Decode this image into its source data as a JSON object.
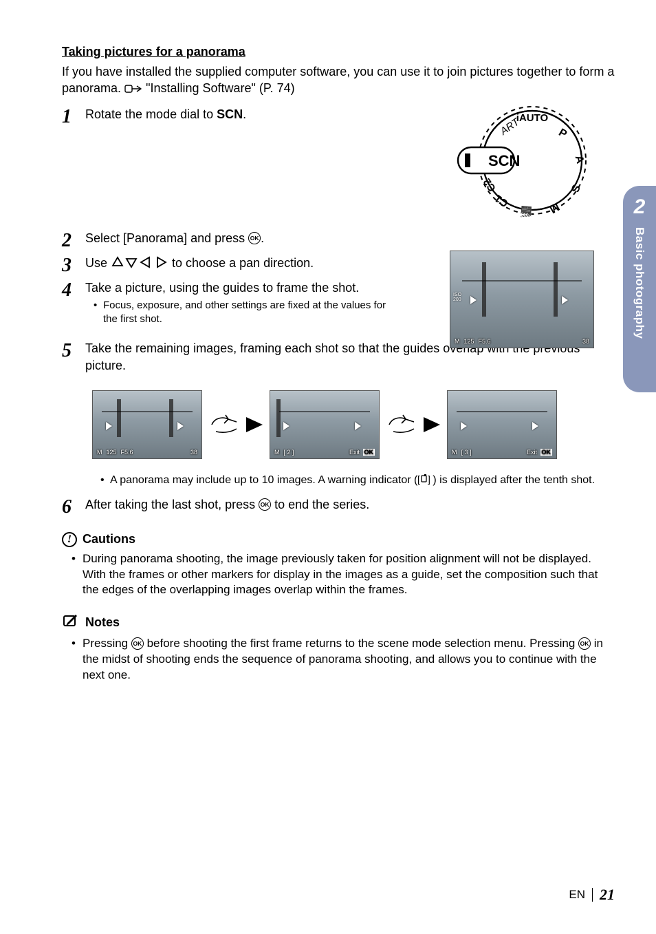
{
  "sideTab": {
    "chapterNum": "2",
    "title": "Basic photography"
  },
  "heading": "Taking pictures for a panorama",
  "intro": {
    "part1": "If you have installed the supplied computer software, you can use it to join pictures together to form a panorama. ",
    "refText": "\"Installing Software\" (P. 74)"
  },
  "steps": {
    "s1": {
      "num": "1",
      "text_a": "Rotate the mode dial to ",
      "scn": "SCN",
      "text_b": "."
    },
    "s2": {
      "num": "2",
      "text_a": "Select [Panorama] and press ",
      "text_b": "."
    },
    "s3": {
      "num": "3",
      "text_a": "Use ",
      "text_b": " to choose a pan direction."
    },
    "s4": {
      "num": "4",
      "text": "Take a picture, using the guides to frame the shot.",
      "bullet": "Focus, exposure, and other settings are fixed at the values for the first shot."
    },
    "s5": {
      "num": "5",
      "text": "Take the remaining images, framing each shot so that the guides overlap with the previous picture.",
      "bullet_a": "A panorama may include up to 10 images. A warning indicator (",
      "bullet_b": ") is displayed after the tenth shot."
    },
    "s6": {
      "num": "6",
      "text_a": "After taking the last shot, press ",
      "text_b": " to end the series."
    }
  },
  "lcd": {
    "iso": "ISO\n200",
    "shutter": "125",
    "aperture": "F5.6",
    "shots": "38",
    "exit": "Exit",
    "ok": "OK",
    "count2": "[ 2 ]",
    "count3": "[ 3 ]",
    "m": "M"
  },
  "dial": {
    "scn": "SCN"
  },
  "cautions": {
    "title": "Cautions",
    "bullet": "During panorama shooting, the image previously taken for position alignment will not be displayed. With the frames or other markers for display in the images as a guide, set the composition such that the edges of the overlapping images overlap within the frames."
  },
  "notes": {
    "title": "Notes",
    "line_a": "Pressing ",
    "line_b": " before shooting the first frame returns to the scene mode selection menu. Pressing ",
    "line_c": " in the midst of shooting ends the sequence of panorama shooting, and allows you to continue with the next one."
  },
  "footer": {
    "lang": "EN",
    "page": "21"
  }
}
